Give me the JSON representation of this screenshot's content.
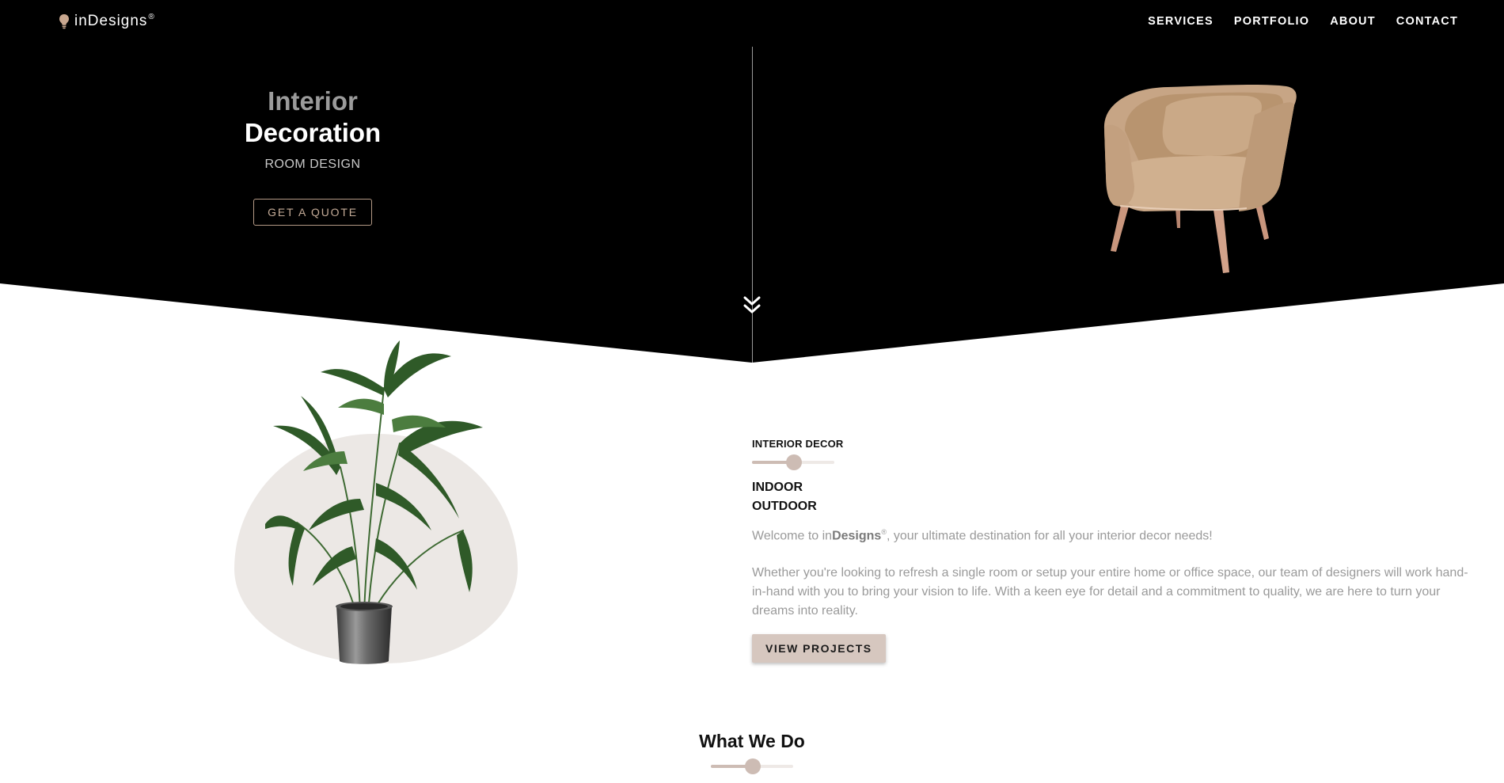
{
  "header": {
    "logo_text": "inDesigns",
    "logo_mark": "®",
    "logo_icon": "lightbulb-icon",
    "nav": [
      "SERVICES",
      "PORTFOLIO",
      "ABOUT",
      "CONTACT"
    ]
  },
  "hero": {
    "title_line1": "Interior",
    "title_line2": "Decoration",
    "subtitle": "ROOM DESIGN",
    "cta_label": "GET A QUOTE",
    "image": "armchair",
    "scroll_icon": "double-chevron-down-icon"
  },
  "about": {
    "image": "potted-palm-plant",
    "eyebrow": "INTERIOR DECOR",
    "tag_line1": "INDOOR",
    "tag_line2": "OUTDOOR",
    "welcome_prefix": "Welcome to in",
    "welcome_brand": "Designs",
    "welcome_mark": "®",
    "welcome_suffix": ", your ultimate destination for all your interior decor needs!",
    "description": "Whether you're looking to refresh a single room or setup your entire home or office space, our team of designers will work hand-in-hand with you to bring your vision to life. With a keen eye for detail and a commitment to quality, we are here to turn your dreams into reality.",
    "cta_label": "VIEW PROJECTS"
  },
  "services": {
    "title": "What We Do"
  },
  "colors": {
    "hero_bg": "#000000",
    "accent": "#d6c7bf",
    "accent_outline": "#b49a86",
    "blob": "#ece8e5"
  }
}
